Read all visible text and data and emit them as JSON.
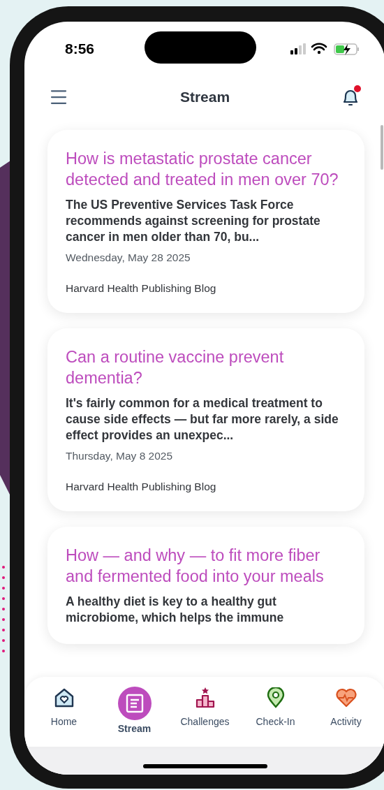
{
  "status_bar": {
    "time": "8:56"
  },
  "header": {
    "title": "Stream",
    "notifications_unread": true
  },
  "articles": [
    {
      "title": "How is metastatic prostate cancer detected and treated in men over 70?",
      "summary": "The US Preventive Services Task Force recommends against screening for prostate cancer in men older than 70, bu...",
      "date": "Wednesday, May 28 2025",
      "source": "Harvard Health Publishing Blog"
    },
    {
      "title": "Can a routine vaccine prevent dementia?",
      "summary": "It's fairly common for a medical treatment to cause side effects — but far more rarely, a side effect provides an unexpec...",
      "date": "Thursday, May 8 2025",
      "source": "Harvard Health Publishing Blog"
    },
    {
      "title": "How — and why — to fit more fiber and fermented food into your meals",
      "summary": "A healthy diet is key to a healthy gut microbiome, which helps the immune"
    }
  ],
  "tab_bar": [
    {
      "kind": "home",
      "label": "Home",
      "selected": false
    },
    {
      "kind": "stream",
      "label": "Stream",
      "selected": true
    },
    {
      "kind": "challenges",
      "label": "Challenges",
      "selected": false
    },
    {
      "kind": "checkin",
      "label": "Check-In",
      "selected": false
    },
    {
      "kind": "activity",
      "label": "Activity",
      "selected": false
    }
  ]
}
